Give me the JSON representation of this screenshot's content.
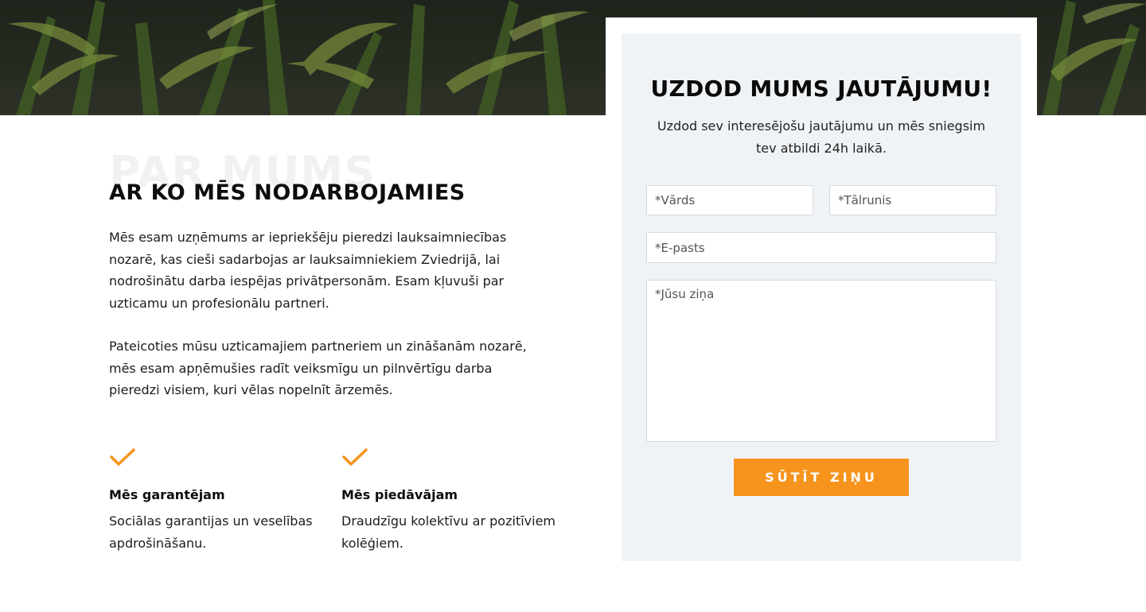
{
  "about": {
    "watermark": "PAR MUMS",
    "heading": "AR KO MĒS NODARBOJAMIES",
    "paragraph1": "Mēs esam uzņēmums ar iepriekšēju pieredzi lauksaimniecības nozarē, kas cieši sadarbojas ar lauksaimniekiem Zviedrijā, lai nodrošinātu darba iespējas privātpersonām. Esam kļuvuši par uzticamu un profesionālu partneri.",
    "paragraph2": "Pateicoties mūsu uzticamajiem partneriem un zināšanām nozarē, mēs esam apņēmušies radīt veiksmīgu un pilnvērtīgu darba pieredzi visiem, kuri vēlas nopelnīt ārzemēs.",
    "features": [
      {
        "icon": "check-icon",
        "title": "Mēs garantējam",
        "text": "Sociālas garantijas un veselības apdrošināšanu."
      },
      {
        "icon": "check-icon",
        "title": "Mēs piedāvājam",
        "text": "Draudzīgu kolektīvu ar pozitīviem kolēģiem."
      }
    ]
  },
  "form": {
    "title": "UZDOD MUMS JAUTĀJUMU!",
    "subtitle": "Uzdod sev interesējošu jautājumu un mēs sniegsim tev atbildi 24h laikā.",
    "name_placeholder": "*Vārds",
    "phone_placeholder": "*Tālrunis",
    "email_placeholder": "*E-pasts",
    "message_placeholder": "*Jūsu ziņa",
    "submit_label": "SŪTĪT ZIŅU"
  },
  "colors": {
    "accent": "#f7941d",
    "card_background": "#f0f3f6"
  }
}
